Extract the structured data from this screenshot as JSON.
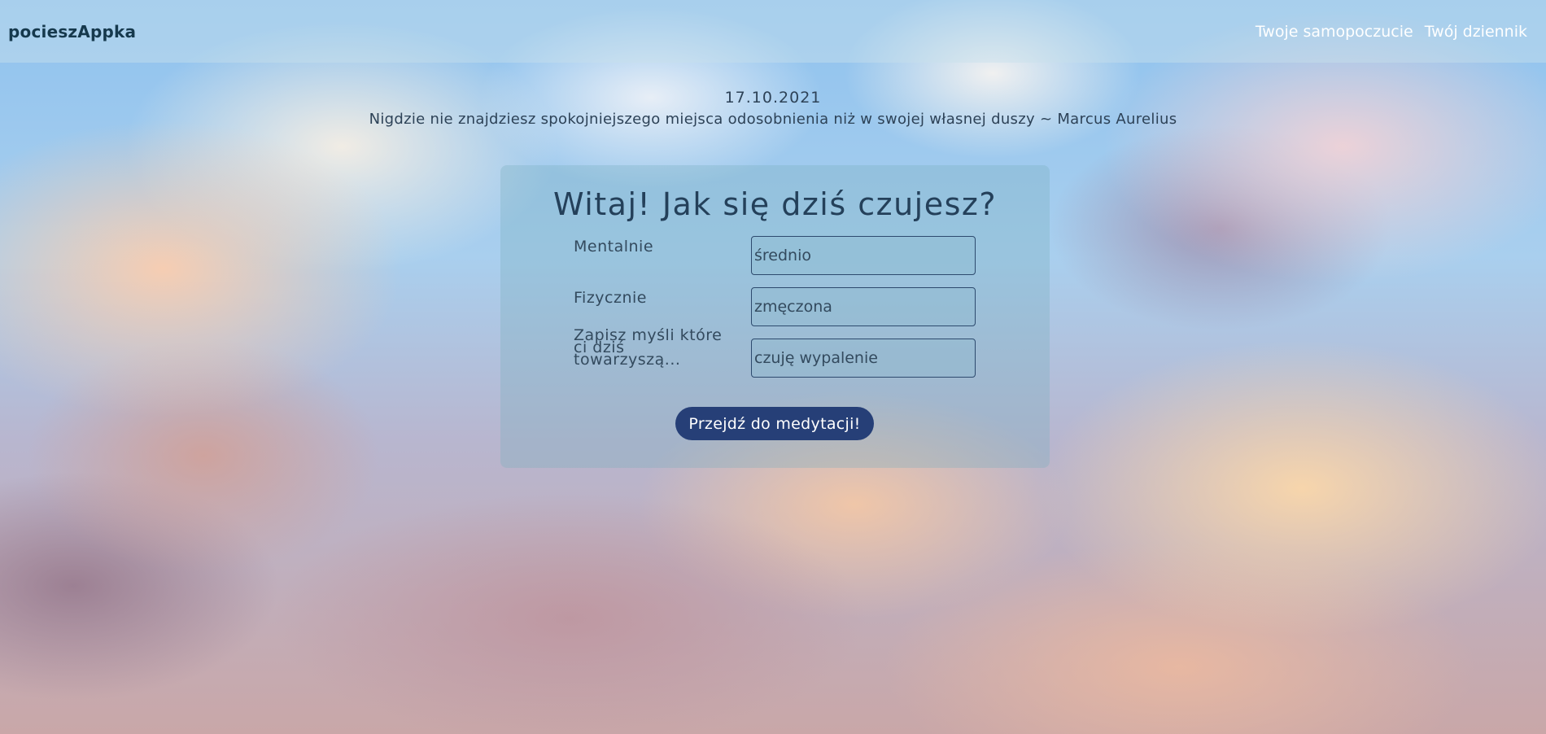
{
  "navbar": {
    "brand": "pocieszAppka",
    "links": [
      "Twoje samopoczucie",
      "Twój dziennik"
    ]
  },
  "header": {
    "date": "17.10.2021",
    "quote": "Nigdzie nie znajdziesz spokojniejszego miejsca odosobnienia niż w swojej własnej duszy ~ Marcus Aurelius"
  },
  "form": {
    "title": "Witaj! Jak się dziś czujesz?",
    "fields": [
      {
        "label": "Mentalnie",
        "value": "średnio"
      },
      {
        "label": "Fizycznie",
        "value": "zmęczona"
      },
      {
        "label": "Zapisz myśli które ci dziś towarzyszą...",
        "value": "czuję wypalenie"
      }
    ],
    "submit_label": "Przejdź do medytacji!"
  },
  "colors": {
    "button_bg": "#263f77",
    "text_dark": "#24405a",
    "nav_link": "#ffffff"
  }
}
